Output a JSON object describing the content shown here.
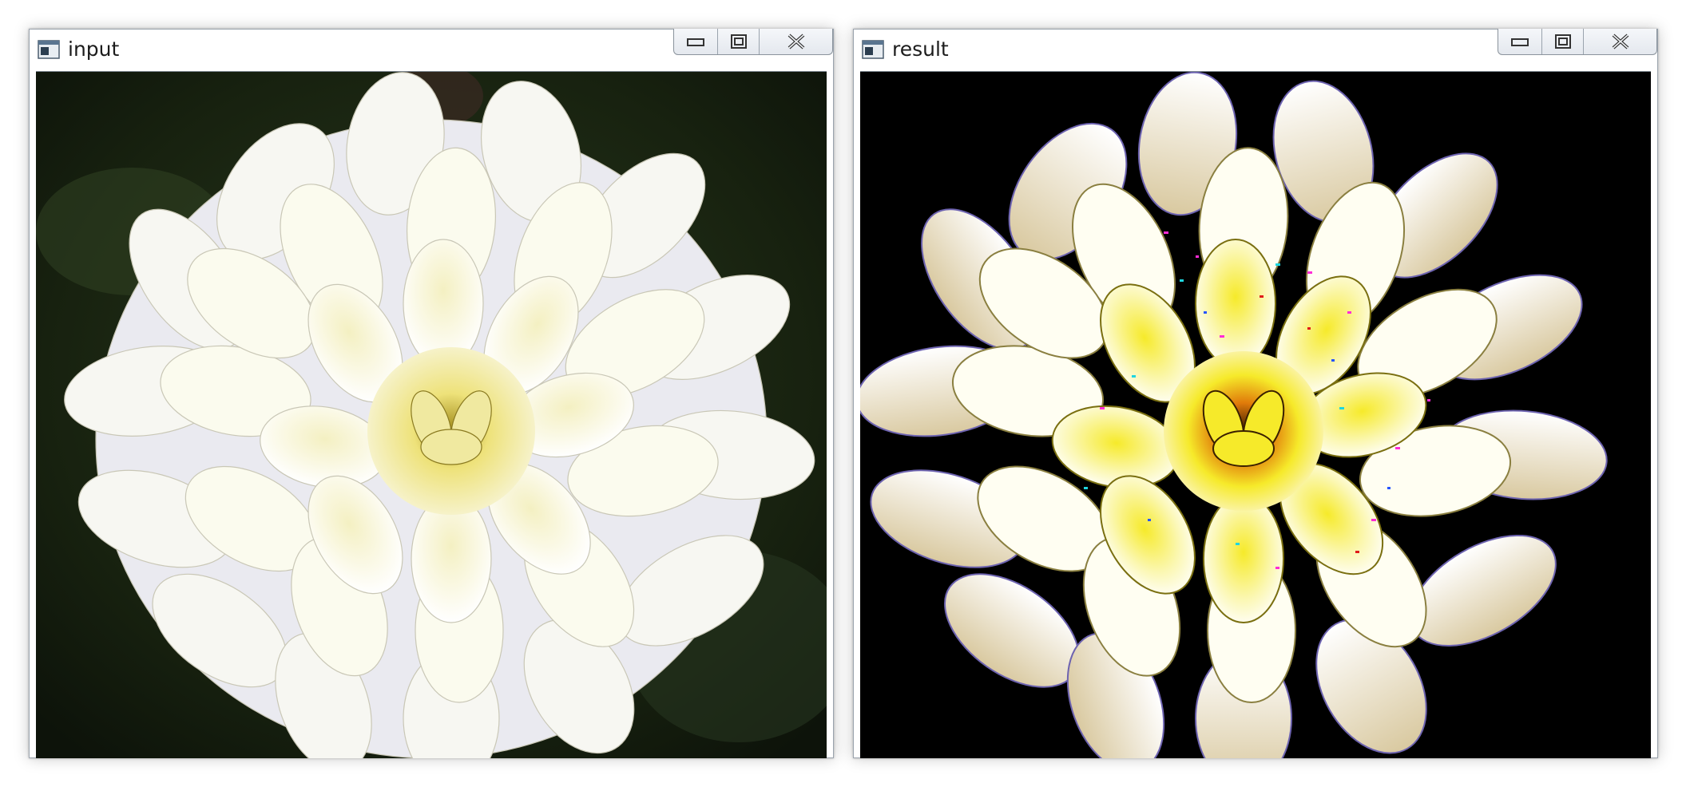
{
  "windows": [
    {
      "title": "input",
      "image_name": "dahlia-original",
      "controls": [
        "minimize-icon",
        "maximize-icon",
        "close-icon"
      ]
    },
    {
      "title": "result",
      "image_name": "dahlia-enhanced",
      "controls": [
        "minimize-icon",
        "maximize-icon",
        "close-icon"
      ]
    }
  ],
  "colors": {
    "input_background": "#1b2316",
    "result_background": "#000000",
    "petal_light": "#fbfbee",
    "petal_cream": "#f4f0c2",
    "result_petal_yellow": "#f6ea2a",
    "result_center": "#e07a0a"
  }
}
